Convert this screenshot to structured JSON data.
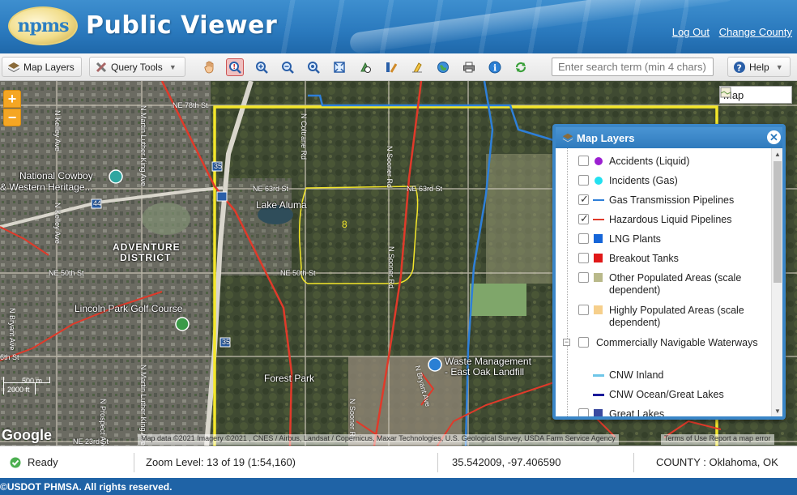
{
  "header": {
    "logo_text": "npms",
    "title": "Public Viewer",
    "links": [
      "Log Out",
      "Change County"
    ]
  },
  "toolbar": {
    "map_layers_label": "Map Layers",
    "query_tools_label": "Query Tools",
    "icons": [
      "pan-hand-icon",
      "identify-icon",
      "zoom-in-icon",
      "zoom-out-icon",
      "zoom-previous-icon",
      "full-extent-icon",
      "clear-icon",
      "draw-icon",
      "eraser-icon",
      "globe-icon",
      "print-icon",
      "info-icon",
      "refresh-icon"
    ],
    "search_placeholder": "Enter search term (min 4 chars)",
    "help_label": "Help"
  },
  "map": {
    "basemap_label": "Map",
    "zoom_in": "+",
    "zoom_out": "−",
    "labels": {
      "cowboy": "National Cowboy",
      "cowboy2": "& Western Heritage...",
      "lake": "Lake Aluma",
      "adventure": "ADVENTURE",
      "district": "DISTRICT",
      "lincoln": "Lincoln Park Golf Course",
      "forest": "Forest Park",
      "waste": "Waste Management",
      "waste2": "- East Oak Landfill",
      "area_num": "8"
    },
    "roads": {
      "ne78": "NE 78th St",
      "ne63": "NE 63rd St",
      "ne63b": "NE 63rd St",
      "ne50": "NE 50th St",
      "ne50b": "NE 50th St",
      "ne36": "6th St",
      "ne23": "NE 23rd St",
      "i35a": "35",
      "i35b": "35",
      "i44": "44",
      "coltrane": "N Coltrane Rd",
      "sooner": "N Sooner Rd",
      "sooner2": "N Sooner Rd",
      "kelley": "N Kelley Ave",
      "kelley2": "N Kelley Ave",
      "mlk": "N Martin Luther King Ave",
      "mlk2": "N Martin Luther King Ave",
      "bryant": "N Bryant Ave",
      "prospect": "N Prospect Ave",
      "rcr": "N Bryant Ave",
      "racked": "N Sooner Rd"
    },
    "scale_top": "500 m",
    "scale_bottom": "2000 ft",
    "google": "Google",
    "attribution": "Map data ©2021 Imagery ©2021 , CNES / Airbus, Landsat / Copernicus, Maxar Technologies, U.S. Geological Survey, USDA Farm Service Agency",
    "attribution_links": "Terms of Use   Report a map error"
  },
  "layers_panel": {
    "title": "Map Layers",
    "items": [
      {
        "label": "Accidents (Liquid)",
        "checked": false,
        "symbol": "dot",
        "color": "#9b1fd1"
      },
      {
        "label": "Incidents (Gas)",
        "checked": false,
        "symbol": "dot",
        "color": "#22e0f0"
      },
      {
        "label": "Gas Transmission Pipelines",
        "checked": true,
        "symbol": "line",
        "color": "#2e7fd8"
      },
      {
        "label": "Hazardous Liquid Pipelines",
        "checked": true,
        "symbol": "line",
        "color": "#e03a2a"
      },
      {
        "label": "LNG Plants",
        "checked": false,
        "symbol": "square",
        "color": "#1565d8"
      },
      {
        "label": "Breakout Tanks",
        "checked": false,
        "symbol": "square",
        "color": "#e01818"
      },
      {
        "label": "Other Populated Areas (scale dependent)",
        "checked": false,
        "symbol": "square",
        "color": "#b9b98a"
      },
      {
        "label": "Highly Populated Areas (scale dependent)",
        "checked": false,
        "symbol": "square",
        "color": "#f6cf8b"
      },
      {
        "label": "Commercially Navigable Waterways",
        "checked": false,
        "symbol": "none",
        "color": ""
      },
      {
        "label": "CNW Inland",
        "checked": false,
        "symbol": "subline",
        "color": "#6fc6e8"
      },
      {
        "label": "CNW Ocean/Great Lakes",
        "checked": false,
        "symbol": "subline",
        "color": "#1a1a9a"
      },
      {
        "label": "Great Lakes",
        "checked": false,
        "symbol": "square",
        "color": "#3a4aa0"
      }
    ]
  },
  "status": {
    "state": "Ready",
    "zoom": "Zoom Level: 13 of 19 (1:54,160)",
    "coords": "35.542009, -97.406590",
    "county": "COUNTY : Oklahoma, OK"
  },
  "footer": "©USDOT PHMSA. All rights reserved."
}
